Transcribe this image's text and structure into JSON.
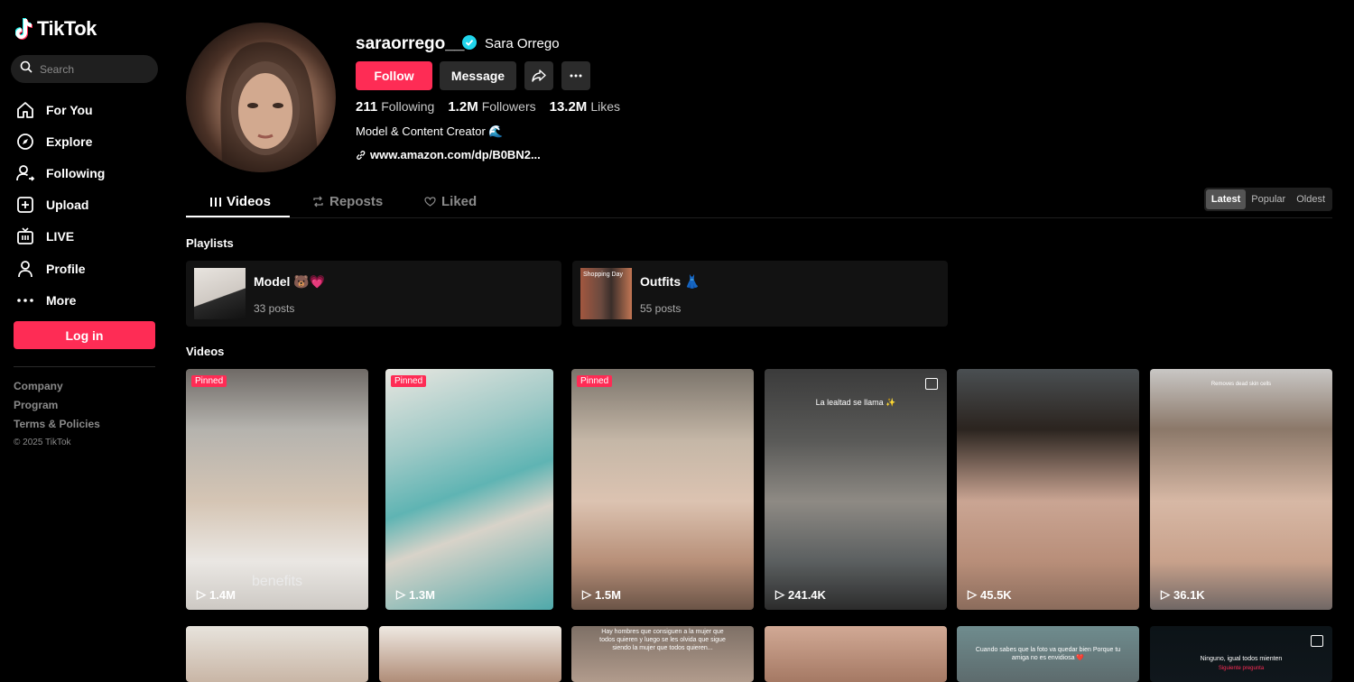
{
  "app": {
    "name": "TikTok",
    "brand_color": "#fe2c55"
  },
  "sidebar": {
    "search_placeholder": "Search",
    "items": [
      {
        "label": "For You",
        "icon": "home-icon"
      },
      {
        "label": "Explore",
        "icon": "compass-icon"
      },
      {
        "label": "Following",
        "icon": "following-icon"
      },
      {
        "label": "Upload",
        "icon": "upload-icon"
      },
      {
        "label": "LIVE",
        "icon": "live-icon"
      },
      {
        "label": "Profile",
        "icon": "profile-icon"
      },
      {
        "label": "More",
        "icon": "more-icon"
      }
    ],
    "login_label": "Log in",
    "footer": [
      "Company",
      "Program",
      "Terms & Policies"
    ],
    "copyright": "© 2025 TikTok"
  },
  "profile": {
    "username": "saraorrego__",
    "display_name": "Sara Orrego",
    "follow_label": "Follow",
    "message_label": "Message",
    "following_count": "211",
    "following_label": "Following",
    "followers_count": "1.2M",
    "followers_label": "Followers",
    "likes_count": "13.2M",
    "likes_label": "Likes",
    "bio": "Model & Content Creator 🌊",
    "link": "www.amazon.com/dp/B0BN2..."
  },
  "tabs": {
    "videos": "Videos",
    "reposts": "Reposts",
    "liked": "Liked"
  },
  "sort": {
    "latest": "Latest",
    "popular": "Popular",
    "oldest": "Oldest"
  },
  "playlists": {
    "title": "Playlists",
    "items": [
      {
        "name": "Model 🐻💗",
        "count": "33 posts"
      },
      {
        "name": "Outfits 👗",
        "count": "55 posts",
        "thumb_text": "Shopping Day"
      }
    ]
  },
  "videos": {
    "title": "Videos",
    "pinned_label": "Pinned",
    "items": [
      {
        "views": "1.4M",
        "pinned": true,
        "caption": "benefits"
      },
      {
        "views": "1.3M",
        "pinned": true
      },
      {
        "views": "1.5M",
        "pinned": true
      },
      {
        "views": "241.4K",
        "caption": "La lealtad se llama ✨",
        "photo": true
      },
      {
        "views": "45.5K"
      },
      {
        "views": "36.1K",
        "caption": "Removes dead skin cells"
      }
    ],
    "row2_captions": [
      "",
      "",
      "Hay hombres que consiguen a la mujer que todos quieren y luego se les olvida que sigue siendo la mujer que todos quieren...",
      "",
      "Cuando sabes que la foto va quedar bien Porque tu amiga no es envidiosa ❤️",
      "Ninguno, igual todos mienten"
    ],
    "row2_subcaption": "Siguiente pregunta"
  }
}
